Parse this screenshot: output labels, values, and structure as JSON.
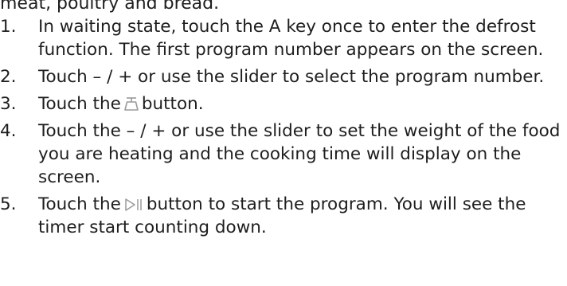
{
  "intro_fragment": "meat, poultry and bread.",
  "steps": [
    {
      "number": "1.",
      "text": "In waiting state, touch the A key once to enter the defrost function. The first program number appears on the screen."
    },
    {
      "number": "2.",
      "text": "Touch – / + or use the slider to select the program number."
    },
    {
      "number": "3.",
      "text_before": "Touch the",
      "icon": "weight-scale-icon",
      "text_after": "button."
    },
    {
      "number": "4.",
      "text": "Touch the – / + or use the slider to set the weight of the food you are heating and the cooking time will display on the screen."
    },
    {
      "number": "5.",
      "text_before": "Touch the",
      "icon": "start-pause-icon",
      "text_after": "button to start the program. You will see the timer start counting down."
    }
  ],
  "colors": {
    "text": "#1e1e1e",
    "icon": "#9a9a9a"
  }
}
